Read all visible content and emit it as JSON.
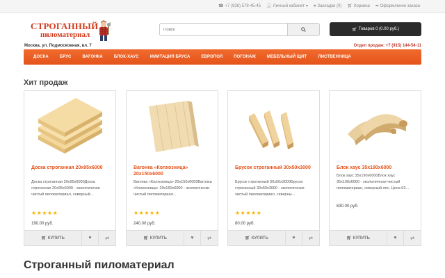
{
  "topnav": {
    "phone": "+7 (926) 579-45-45",
    "account": "Личный кабинет",
    "bookmarks": "Закладки (0)",
    "cart": "Корзина",
    "checkout": "Оформление заказа"
  },
  "logo": {
    "line1": "Строганный",
    "line2": "пиломатериал"
  },
  "search": {
    "placeholder": "Поиск"
  },
  "cart_button": {
    "label": "Товаров 0 (0.00 руб.)"
  },
  "address": "Москва, ул. Подмосковная, вл. 7",
  "sales": {
    "label": "Отдел продаж:",
    "phone": "+7 (915) 144-54-11"
  },
  "menu": [
    "ДОСКА",
    "БРУС",
    "ВАГОНКА",
    "БЛОК-ХАУС",
    "ИМИТАЦИЯ БРУСА",
    "ЕВРОПОЛ",
    "ПОГОНАЖ",
    "МЕБЕЛЬНЫЙ ЩИТ",
    "ЛИСТВЕННИЦА"
  ],
  "section_title": "Хит продаж",
  "products": [
    {
      "name": "Доска строганная 20х95х6000",
      "desc": "Доска строганная 20х95х6000Доска строганная 20х95х6000 - экологически чистый пиломатериал, северный...",
      "stars": "★★★★★",
      "price": "190.00 руб."
    },
    {
      "name": "Вагонка «Колхозница» 20х150х6000",
      "desc": "Вагонка «Колхозница» 20х150х6000Вагонка «Колхозница» 20х150х6000 - экологически чистый пиломатериал...",
      "stars": "★★★★★",
      "price": "240.00 руб."
    },
    {
      "name": "Брусок строганный 30х50х3000",
      "desc": "Брусок строганный 30х50х3000Брусок строганный 30х50х3000 - экологически чистый пиломатериал, северны...",
      "stars": "★★★★★",
      "price": "80.00 руб."
    },
    {
      "name": "Блок хаус 35х190х6000",
      "desc": "Блок хаус 35х190х6000Блок хаус 35х190х6000 - экологически чистый пиломатериал, северный лес. Цена 63...",
      "stars": "",
      "price": "630.00 руб."
    }
  ],
  "buy_label": "КУПИТЬ",
  "bottom_title": "Строганный пиломатериал",
  "colors": {
    "accent": "#e5531a",
    "star": "#f5b300",
    "dark": "#2b2b2b"
  }
}
